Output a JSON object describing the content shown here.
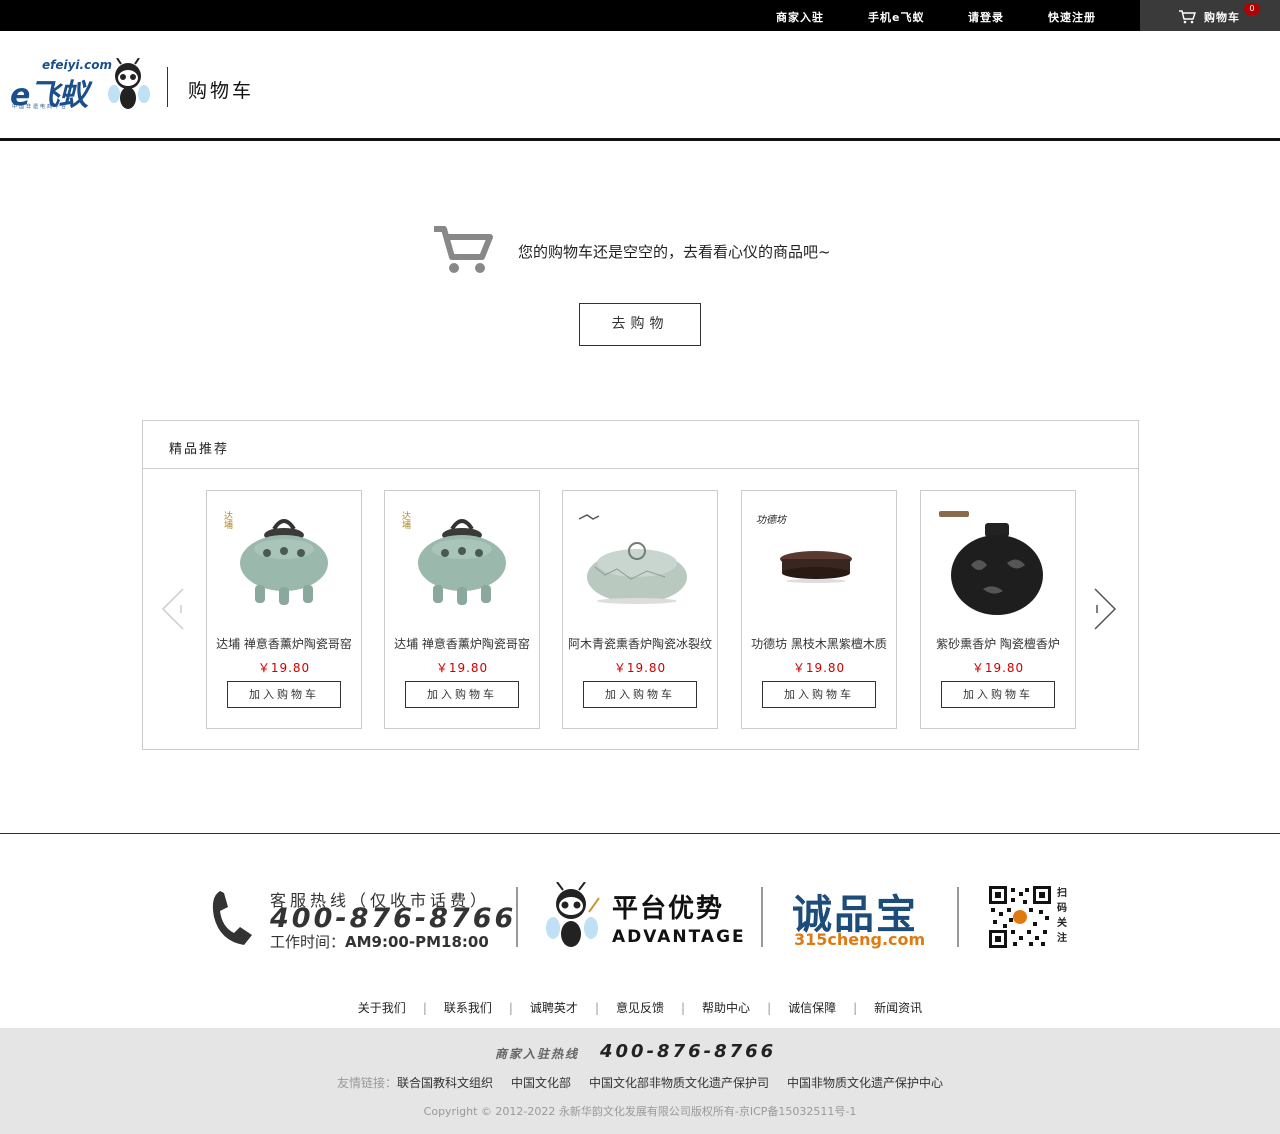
{
  "topbar": {
    "merchant_join": "商家入驻",
    "mobile": "手机e飞蚁",
    "login": "请登录",
    "register": "快速注册",
    "cart_label": "购物车",
    "cart_count": "0",
    "cart_icon": "cart-icon"
  },
  "header": {
    "logo_domain": "efeiyi.com",
    "logo_word": "e飞蚁",
    "logo_tagline": "中国非遗电商平台",
    "page_title": "购物车"
  },
  "empty_cart": {
    "icon": "cart-icon",
    "message": "您的购物车还是空空的，去看看心仪的商品吧~",
    "go_shopping": "去购物"
  },
  "recommend": {
    "title": "精品推荐",
    "prev_icon": "chevron-left-icon",
    "next_icon": "chevron-right-icon",
    "products": [
      {
        "brand": "达埔",
        "name": "达埔 禅意香薰炉陶瓷哥窑",
        "price": "￥19.80",
        "add": "加入购物车"
      },
      {
        "brand": "达埔",
        "name": "达埔 禅意香薰炉陶瓷哥窑",
        "price": "￥19.80",
        "add": "加入购物车"
      },
      {
        "brand": "",
        "name": "阿木青瓷熏香炉陶瓷冰裂纹",
        "price": "￥19.80",
        "add": "加入购物车"
      },
      {
        "brand": "功德坊",
        "name": "功德坊 黑枝木黑紫檀木质",
        "price": "￥19.80",
        "add": "加入购物车"
      },
      {
        "brand": "",
        "name": "紫砂熏香炉 陶瓷檀香炉",
        "price": "￥19.80",
        "add": "加入购物车"
      }
    ]
  },
  "footer": {
    "hotline_label": "客服热线（仅收市话费）",
    "hotline_number": "400-876-8766",
    "hours_label": "工作时间：",
    "hours_value": "AM9:00-PM18:00",
    "advantage_title": "平台优势",
    "advantage_sub": "ADVANTAGE",
    "chengpinbao": "诚品宝",
    "chengpinbao_url": "315cheng.com",
    "qr_text": "扫码关注",
    "links": [
      "关于我们",
      "联系我们",
      "诚聘英才",
      "意见反馈",
      "帮助中心",
      "诚信保障",
      "新闻资讯"
    ],
    "merchant_hotline_label": "商家入驻热线",
    "merchant_hotline_number": "400-876-8766",
    "friend_label": "友情链接：",
    "friend_links": [
      "联合国教科文组织",
      "中国文化部",
      "中国文化部非物质文化遗产保护司",
      "中国非物质文化遗产保护中心"
    ],
    "copyright": "Copyright © 2012-2022 永新华韵文化发展有限公司版权所有-京ICP备15032511号-1"
  },
  "colors": {
    "topbar_bg": "#000000",
    "price": "#cc0000",
    "logo_blue": "#1a4f8b",
    "badge": "#b30000"
  }
}
